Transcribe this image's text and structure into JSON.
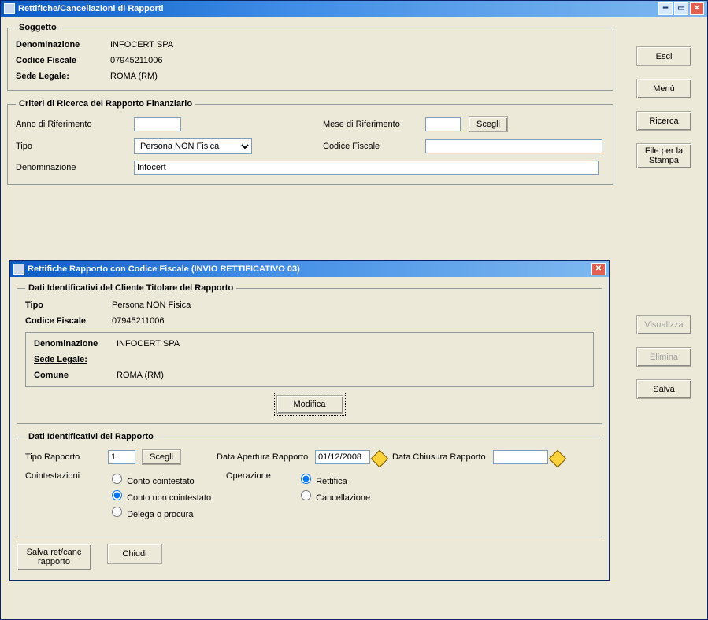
{
  "main_window": {
    "title": "Rettifiche/Cancellazioni di Rapporti"
  },
  "soggetto": {
    "legend": "Soggetto",
    "denominazione_lbl": "Denominazione",
    "denominazione_val": "INFOCERT SPA",
    "codice_fiscale_lbl": "Codice Fiscale",
    "codice_fiscale_val": "07945211006",
    "sede_legale_lbl": "Sede Legale:",
    "sede_legale_val": "ROMA (RM)"
  },
  "criteri": {
    "legend": "Criteri di Ricerca del Rapporto Finanziario",
    "anno_lbl": "Anno di Riferimento",
    "anno_val": "",
    "mese_lbl": "Mese di Riferimento",
    "mese_val": "",
    "scegli_lbl": "Scegli",
    "tipo_lbl": "Tipo",
    "tipo_val": "Persona NON Fisica",
    "cf_lbl": "Codice Fiscale",
    "cf_val": "",
    "denom_lbl": "Denominazione",
    "denom_val": "Infocert"
  },
  "side": {
    "esci": "Esci",
    "menu": "Menù",
    "ricerca": "Ricerca",
    "file_stampa": "File per la Stampa",
    "visualizza": "Visualizza",
    "elimina": "Elimina",
    "salva": "Salva"
  },
  "dialog": {
    "title": "Rettifiche Rapporto con Codice Fiscale (INVIO RETTIFICATIVO 03)",
    "cliente": {
      "legend": "Dati Identificativi del Cliente Titolare del Rapporto",
      "tipo_lbl": "Tipo",
      "tipo_val": "Persona NON Fisica",
      "cf_lbl": "Codice Fiscale",
      "cf_val": "07945211006",
      "denom_lbl": "Denominazione",
      "denom_val": "INFOCERT SPA",
      "sede_lbl": "Sede Legale:",
      "comune_lbl": "Comune",
      "comune_val": "ROMA (RM)",
      "modifica_lbl": "Modifica"
    },
    "rapporto": {
      "legend": "Dati Identificativi del Rapporto",
      "tipo_rapp_lbl": "Tipo Rapporto",
      "tipo_rapp_val": "1",
      "scegli_lbl": "Scegli",
      "data_apertura_lbl": "Data Apertura Rapporto",
      "data_apertura_val": "01/12/2008",
      "data_chiusura_lbl": "Data Chiusura Rapporto",
      "data_chiusura_val": "",
      "cointest_lbl": "Cointestazioni",
      "cointest_opts": {
        "a": "Conto cointestato",
        "b": "Conto non cointestato",
        "c": "Delega o procura"
      },
      "operazione_lbl": "Operazione",
      "operazione_opts": {
        "a": "Rettifica",
        "b": "Cancellazione"
      }
    },
    "footer": {
      "salva_ret": "Salva ret/canc rapporto",
      "chiudi": "Chiudi"
    }
  }
}
